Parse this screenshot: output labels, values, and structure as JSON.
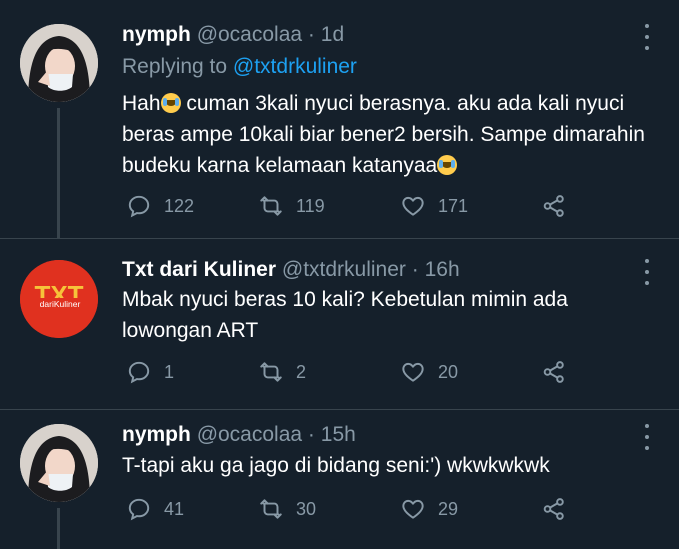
{
  "tweets": [
    {
      "name": "nymph",
      "handle": "@ocacolaa",
      "dot": "·",
      "time": "1d",
      "reply_prefix": "Replying to",
      "reply_handle": "@txtdrkuliner",
      "text_parts": [
        "Hah",
        " cuman 3kali nyuci berasnya. aku ada kali nyuci beras ampe 10kali biar bener2 bersih. Sampe dimarahin budeku karna kelamaan katanyaa"
      ],
      "replies": "122",
      "retweets": "119",
      "likes": "171"
    },
    {
      "name": "Txt dari Kuliner",
      "handle": "@txtdrkuliner",
      "dot": "·",
      "time": "16h",
      "logo_big": "TXT",
      "logo_small": "dariKuliner",
      "text": "Mbak nyuci beras 10 kali? Kebetulan mimin ada lowongan ART",
      "replies": "1",
      "retweets": "2",
      "likes": "20"
    },
    {
      "name": "nymph",
      "handle": "@ocacolaa",
      "dot": "·",
      "time": "15h",
      "text": "T-tapi aku ga jago di bidang seni:') wkwkwkwk",
      "replies": "41",
      "retweets": "30",
      "likes": "29"
    }
  ],
  "icons": {
    "reply": "reply-icon",
    "retweet": "retweet-icon",
    "like": "heart-icon",
    "share": "share-icon",
    "more": "more-vertical-icon",
    "emoji": "loudly-crying-face-emoji"
  },
  "colors": {
    "background": "#15202b",
    "muted": "#8899a6",
    "link": "#1da1f2",
    "logo_red": "#e0311f"
  }
}
